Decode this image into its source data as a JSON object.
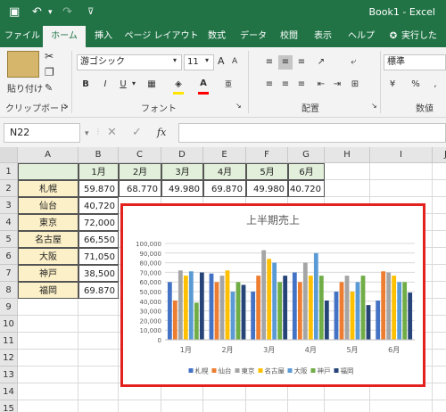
{
  "titlebar": {
    "save_icon": "save-icon",
    "undo_icon": "undo-icon",
    "redo_icon": "redo-icon",
    "customize_icon": "customize-quick-access-icon",
    "title": "Book1 - Excel"
  },
  "tabs": [
    "ファイル",
    "ホーム",
    "挿入",
    "ページ レイアウト",
    "数式",
    "データ",
    "校閲",
    "表示",
    "ヘルプ",
    "実行した"
  ],
  "tabs_search_icon": "lightbulb-icon",
  "ribbon": {
    "paste_label": "貼り付け",
    "font_name": "游ゴシック",
    "font_size": "11",
    "bold": "B",
    "italic": "I",
    "underline": "U",
    "number_format": "標準",
    "clipboard_label": "クリップボード",
    "font_label": "フォント",
    "alignment_label": "配置",
    "number_label": "数値"
  },
  "formula_bar": {
    "name_box": "N22",
    "fx": "fx"
  },
  "columns": [
    "A",
    "B",
    "C",
    "D",
    "E",
    "F",
    "G",
    "H",
    "I",
    "J"
  ],
  "rows": [
    "1",
    "2",
    "3",
    "4",
    "5",
    "6",
    "7",
    "8",
    "9",
    "10",
    "11",
    "12",
    "13",
    "14",
    "15"
  ],
  "table": {
    "months": [
      "1月",
      "2月",
      "3月",
      "4月",
      "5月",
      "6月"
    ],
    "row2": [
      "59.870",
      "68.770",
      "49.980",
      "69.870",
      "49.980",
      "40.720"
    ],
    "cities": [
      "札幌",
      "仙台",
      "東京",
      "名古屋",
      "大阪",
      "神戸",
      "福岡"
    ],
    "col_b": [
      "59.870",
      "40,720",
      "72,000",
      "66,550",
      "71,050",
      "38,500",
      "69.870"
    ]
  },
  "chart_data": {
    "type": "bar",
    "title": "上半期売上",
    "categories": [
      "1月",
      "2月",
      "3月",
      "4月",
      "5月",
      "6月"
    ],
    "ylim": [
      0,
      100000
    ],
    "yticks": [
      "0",
      "10,000",
      "20,000",
      "30,000",
      "40,000",
      "50,000",
      "60,000",
      "70,000",
      "80,000",
      "90,000",
      "100,000"
    ],
    "grid": true,
    "legend_position": "bottom",
    "series": [
      {
        "name": "札幌",
        "color": "#4472c4",
        "values": [
          59870,
          68770,
          49980,
          69870,
          49980,
          40720
        ]
      },
      {
        "name": "仙台",
        "color": "#ed7d31",
        "values": [
          40720,
          59870,
          66550,
          59870,
          59870,
          71050
        ]
      },
      {
        "name": "東京",
        "color": "#a5a5a5",
        "values": [
          72000,
          66550,
          93000,
          80000,
          66550,
          69870
        ]
      },
      {
        "name": "名古屋",
        "color": "#ffc000",
        "values": [
          66550,
          72000,
          84000,
          66550,
          49980,
          66550
        ]
      },
      {
        "name": "大阪",
        "color": "#5b9bd5",
        "values": [
          71050,
          49980,
          80000,
          90000,
          59870,
          59870
        ]
      },
      {
        "name": "神戸",
        "color": "#70ad47",
        "values": [
          38500,
          59870,
          59870,
          66550,
          66550,
          59870
        ]
      },
      {
        "name": "福岡",
        "color": "#264478",
        "values": [
          69870,
          57000,
          66550,
          40720,
          36000,
          49000
        ]
      }
    ]
  }
}
